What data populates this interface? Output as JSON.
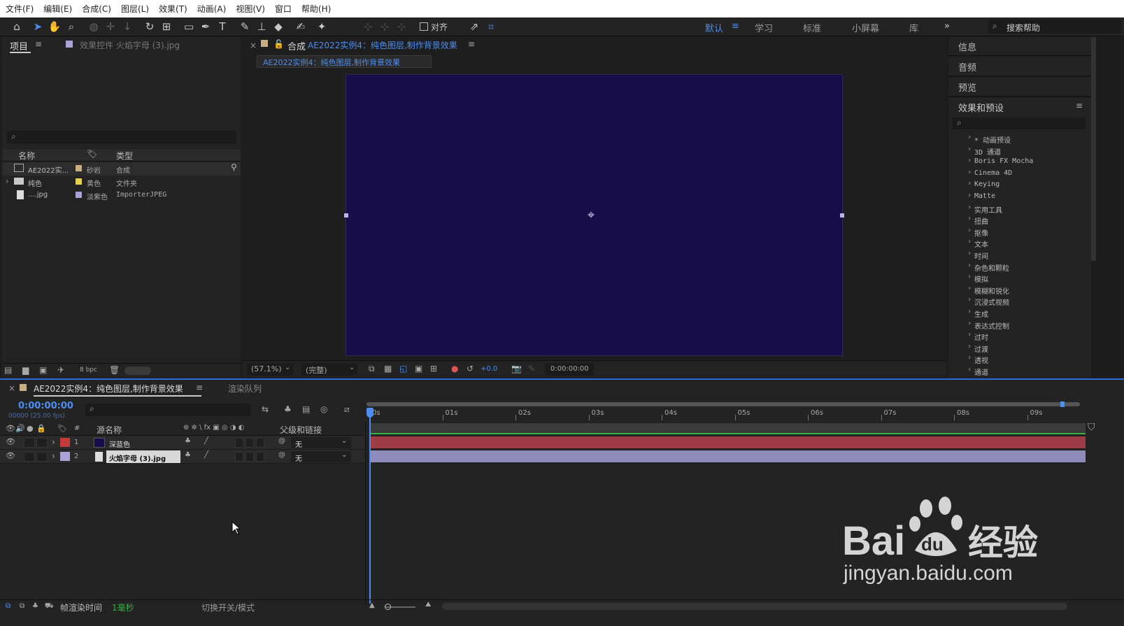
{
  "menu": [
    "文件(F)",
    "编辑(E)",
    "合成(C)",
    "图层(L)",
    "效果(T)",
    "动画(A)",
    "视图(V)",
    "窗口",
    "帮助(H)"
  ],
  "toolbar": {
    "align_label": "对齐",
    "workspaces": [
      "默认",
      "学习",
      "标准",
      "小屏幕",
      "库"
    ],
    "search_help": "搜索帮助"
  },
  "project": {
    "tab": "项目",
    "effects_tab": "效果控件 火焰字母 (3).jpg",
    "col_name": "名称",
    "col_type": "类型",
    "rows": [
      {
        "name": "AE2022实...",
        "label_color": "#c9ae84",
        "label": "砂岩",
        "type": "合成"
      },
      {
        "name": "纯色",
        "label_color": "#e6d24c",
        "label": "黄色",
        "type": "文件夹"
      },
      {
        "name": "....jpg",
        "label_color": "#a9a4d4",
        "label": "淡紫色",
        "type": "ImporterJPEG"
      }
    ],
    "bpc": "8 bpc"
  },
  "comp": {
    "prefix": "合成",
    "name": "AE2022实例4：纯色图层,制作背景效果",
    "breadcrumb": "AE2022实例4：纯色图层,制作背景效果",
    "solid_color": "#170e4a",
    "zoom": "(57.1%)",
    "quality": "(完整)",
    "exposure": "+0.0",
    "timecode": "0:00:00:00"
  },
  "right": {
    "info": "信息",
    "audio": "音频",
    "preview": "预览",
    "effects_title": "效果和预设",
    "effects": [
      "* 动画预设",
      "3D 通道",
      "Boris FX Mocha",
      "Cinema 4D",
      "Keying",
      "Matte",
      "实用工具",
      "扭曲",
      "抠像",
      "文本",
      "时间",
      "杂色和颗粒",
      "模拟",
      "模糊和锐化",
      "沉浸式视频",
      "生成",
      "表达式控制",
      "过时",
      "过渡",
      "透视",
      "通道"
    ]
  },
  "timeline": {
    "tab": "AE2022实例4：纯色图层,制作背景效果",
    "render_queue": "渲染队列",
    "timecode": "0:00:00:00",
    "frames": "00000 (25.00 fps)",
    "col_source": "源名称",
    "col_parent": "父级和链接",
    "layers": [
      {
        "num": "1",
        "name": "深蓝色",
        "label_color": "#c13a3a",
        "parent": "无",
        "bar_color": "#9e3c45"
      },
      {
        "num": "2",
        "name": "火焰字母 (3).jpg",
        "label_color": "#a9a4d4",
        "parent": "无",
        "bar_color": "#8f8cbb"
      }
    ],
    "ticks": [
      "0s",
      "01s",
      "02s",
      "03s",
      "04s",
      "05s",
      "06s",
      "07s",
      "08s",
      "09s"
    ],
    "render_time_label": "帧渲染时间",
    "render_time_value": "1毫秒",
    "toggle_label": "切换开关/模式"
  },
  "watermark": {
    "brand": "Bai du 经验",
    "url": "jingyan.baidu.com"
  }
}
